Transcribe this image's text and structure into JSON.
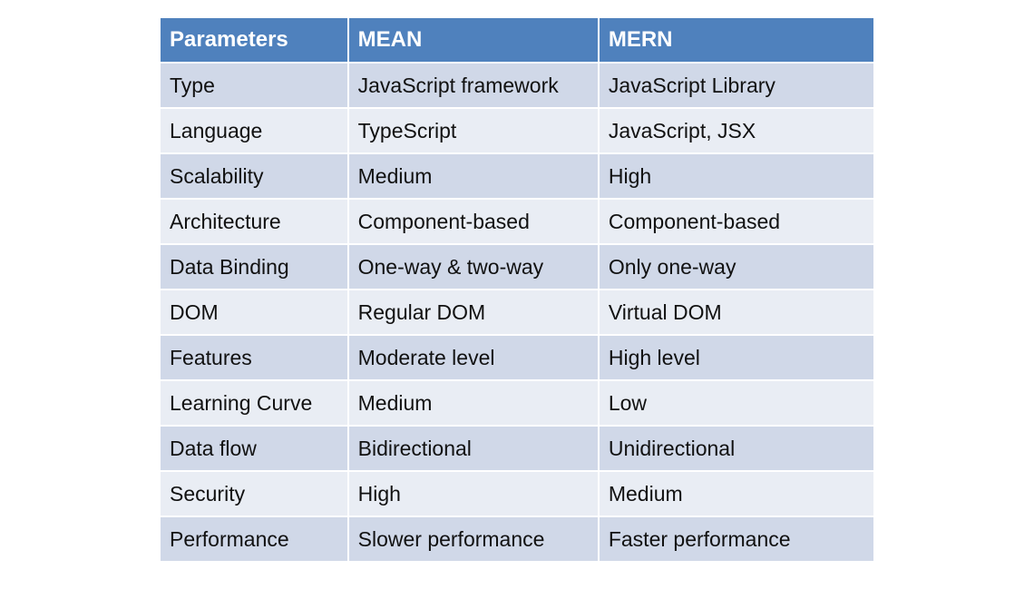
{
  "table": {
    "headers": [
      "Parameters",
      "MEAN",
      "MERN"
    ],
    "rows": [
      [
        "Type",
        "JavaScript framework",
        "JavaScript Library"
      ],
      [
        "Language",
        "TypeScript",
        "JavaScript, JSX"
      ],
      [
        "Scalability",
        "Medium",
        "High"
      ],
      [
        "Architecture",
        "Component-based",
        "Component-based"
      ],
      [
        "Data Binding",
        "One-way & two-way",
        "Only one-way"
      ],
      [
        "DOM",
        "Regular DOM",
        "Virtual DOM"
      ],
      [
        "Features",
        "Moderate level",
        "High level"
      ],
      [
        "Learning Curve",
        "Medium",
        "Low"
      ],
      [
        "Data flow",
        "Bidirectional",
        "Unidirectional"
      ],
      [
        "Security",
        "High",
        "Medium"
      ],
      [
        "Performance",
        "Slower performance",
        "Faster performance"
      ]
    ]
  },
  "colors": {
    "header": "#4F81BD",
    "row_dark": "#D0D8E8",
    "row_light": "#E9EDF4"
  }
}
